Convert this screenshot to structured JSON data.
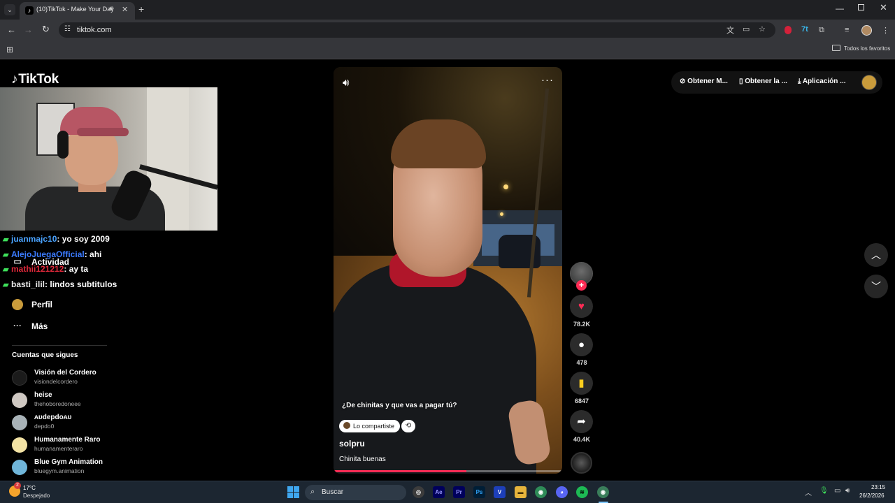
{
  "browser": {
    "tab_title": "(10)TikTok - Make Your Day",
    "url": "tiktok.com",
    "bookmarks_all": "Todos los favoritos"
  },
  "tiktok": {
    "logo_text": "TikTok",
    "chat": [
      {
        "user": "juanmajc10",
        "message": ": yo soy 2009",
        "color": "#4aa3ff"
      },
      {
        "user": "AlejoJuegaOfficial",
        "message": ": ahi",
        "color": "#3b7bff"
      },
      {
        "user": "mathii121212",
        "message": ": ay ta",
        "color": "#e0283a"
      },
      {
        "user": "basti_ilil",
        "message": ": lindos subtitulos",
        "color": "#e8e8e8"
      }
    ],
    "sidebar": {
      "actividad": "Actividad",
      "perfil": "Perfil",
      "mas": "Más"
    },
    "following": {
      "heading": "Cuentas que sigues",
      "accounts": [
        {
          "name": "Visión del Cordero",
          "handle": "visiondelcordero",
          "color": "#1b1b1b"
        },
        {
          "name": "heise",
          "handle": "thehoboredoneee",
          "color": "#cfc8c2"
        },
        {
          "name": "ᴀᴜdepdoᴀᴜ",
          "handle": "depdo0",
          "color": "#a9b3b8"
        },
        {
          "name": "Humanamente Raro",
          "handle": "humanamenteraro",
          "color": "#f2e2a4"
        },
        {
          "name": "Blue Gym Animation",
          "handle": "bluegym.animation",
          "color": "#6fb5d9"
        }
      ]
    },
    "video": {
      "question": "¿De chinitas y que vas a pagar tú?",
      "shared_label": "Lo compartiste",
      "author": "solpru",
      "caption": "Chinita buenas",
      "progress": 0.58
    },
    "actions": {
      "likes": "78.2K",
      "comments": "478",
      "saves": "6847",
      "shares": "40.4K"
    },
    "top_actions": {
      "obtain_m": "Obtener M...",
      "obtain_app": "Obtener la ...",
      "download_app": "Aplicación ..."
    }
  },
  "taskbar": {
    "temperature": "17°C",
    "weather": "Despejado",
    "weather_badge": "2",
    "search_placeholder": "Buscar",
    "time": "23:15",
    "date": "26/2/2026"
  },
  "colors": {
    "accent": "#fe2c55",
    "taskbar": "#1c2631"
  }
}
